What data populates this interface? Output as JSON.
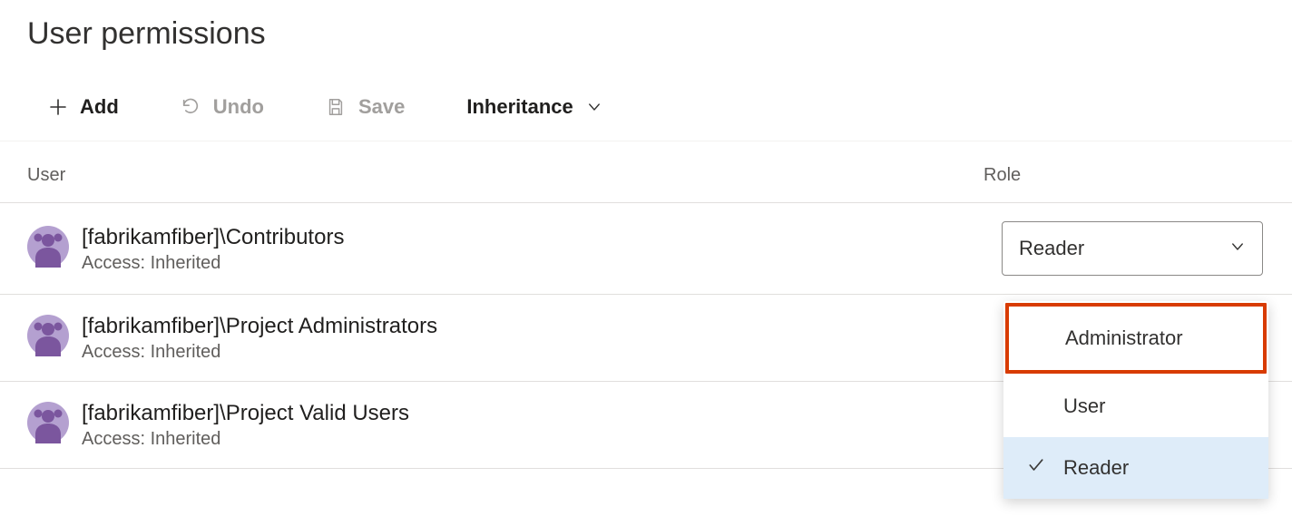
{
  "page_title": "User permissions",
  "toolbar": {
    "add_label": "Add",
    "undo_label": "Undo",
    "save_label": "Save",
    "inheritance_label": "Inheritance"
  },
  "columns": {
    "user": "User",
    "role": "Role"
  },
  "rows": [
    {
      "name": "[fabrikamfiber]\\Contributors",
      "access": "Access: Inherited",
      "role": "Reader"
    },
    {
      "name": "[fabrikamfiber]\\Project Administrators",
      "access": "Access: Inherited",
      "role": ""
    },
    {
      "name": "[fabrikamfiber]\\Project Valid Users",
      "access": "Access: Inherited",
      "role": ""
    }
  ],
  "dropdown": {
    "options": [
      "Administrator",
      "User",
      "Reader"
    ],
    "selected": "Reader",
    "highlighted": "Administrator"
  },
  "colors": {
    "avatar_bg": "#b4a0d0",
    "avatar_fg": "#7b569e",
    "highlight_border": "#d83b01",
    "row_selected_bg": "#deecf9"
  }
}
